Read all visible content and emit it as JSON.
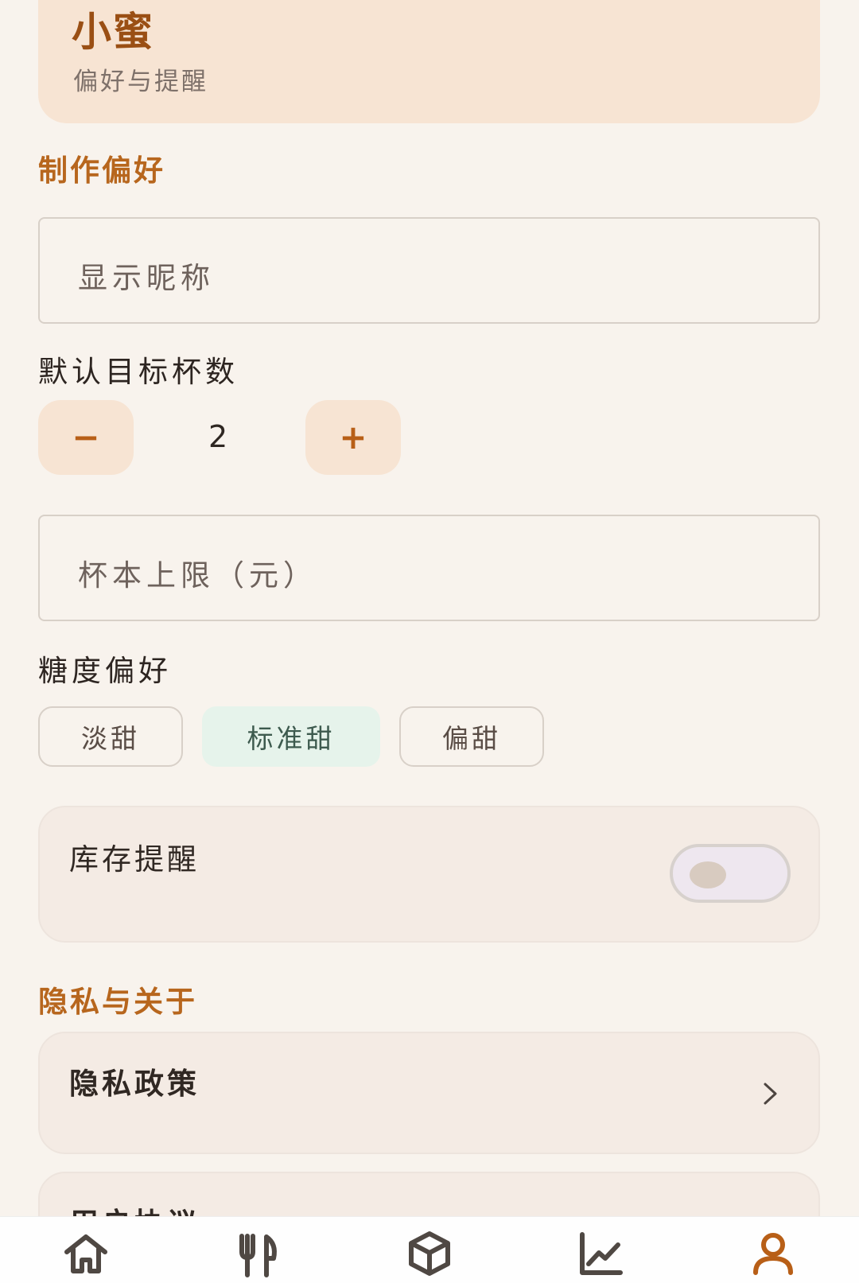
{
  "header": {
    "title": "小蜜",
    "subtitle": "偏好与提醒"
  },
  "sections": {
    "production": "制作偏好",
    "privacy": "隐私与关于"
  },
  "fields": {
    "nickname_placeholder": "显示昵称",
    "cost_limit_placeholder": "杯本上限（元）"
  },
  "cups": {
    "label": "默认目标杯数",
    "minus": "−",
    "value": "2",
    "plus": "+"
  },
  "sugar": {
    "label": "糖度偏好",
    "options": [
      "淡甜",
      "标准甜",
      "偏甜"
    ],
    "selected": "标准甜"
  },
  "reminder": {
    "label": "库存提醒",
    "enabled": false
  },
  "privacy_links": [
    "隐私政策",
    "用户协议"
  ],
  "bottom_nav": {
    "active": "profile",
    "items": [
      "home-icon",
      "utensils-icon",
      "box-icon",
      "trend-chart-icon",
      "user-icon"
    ],
    "active_color": "#b85f17",
    "inactive_color": "#4f4843"
  }
}
